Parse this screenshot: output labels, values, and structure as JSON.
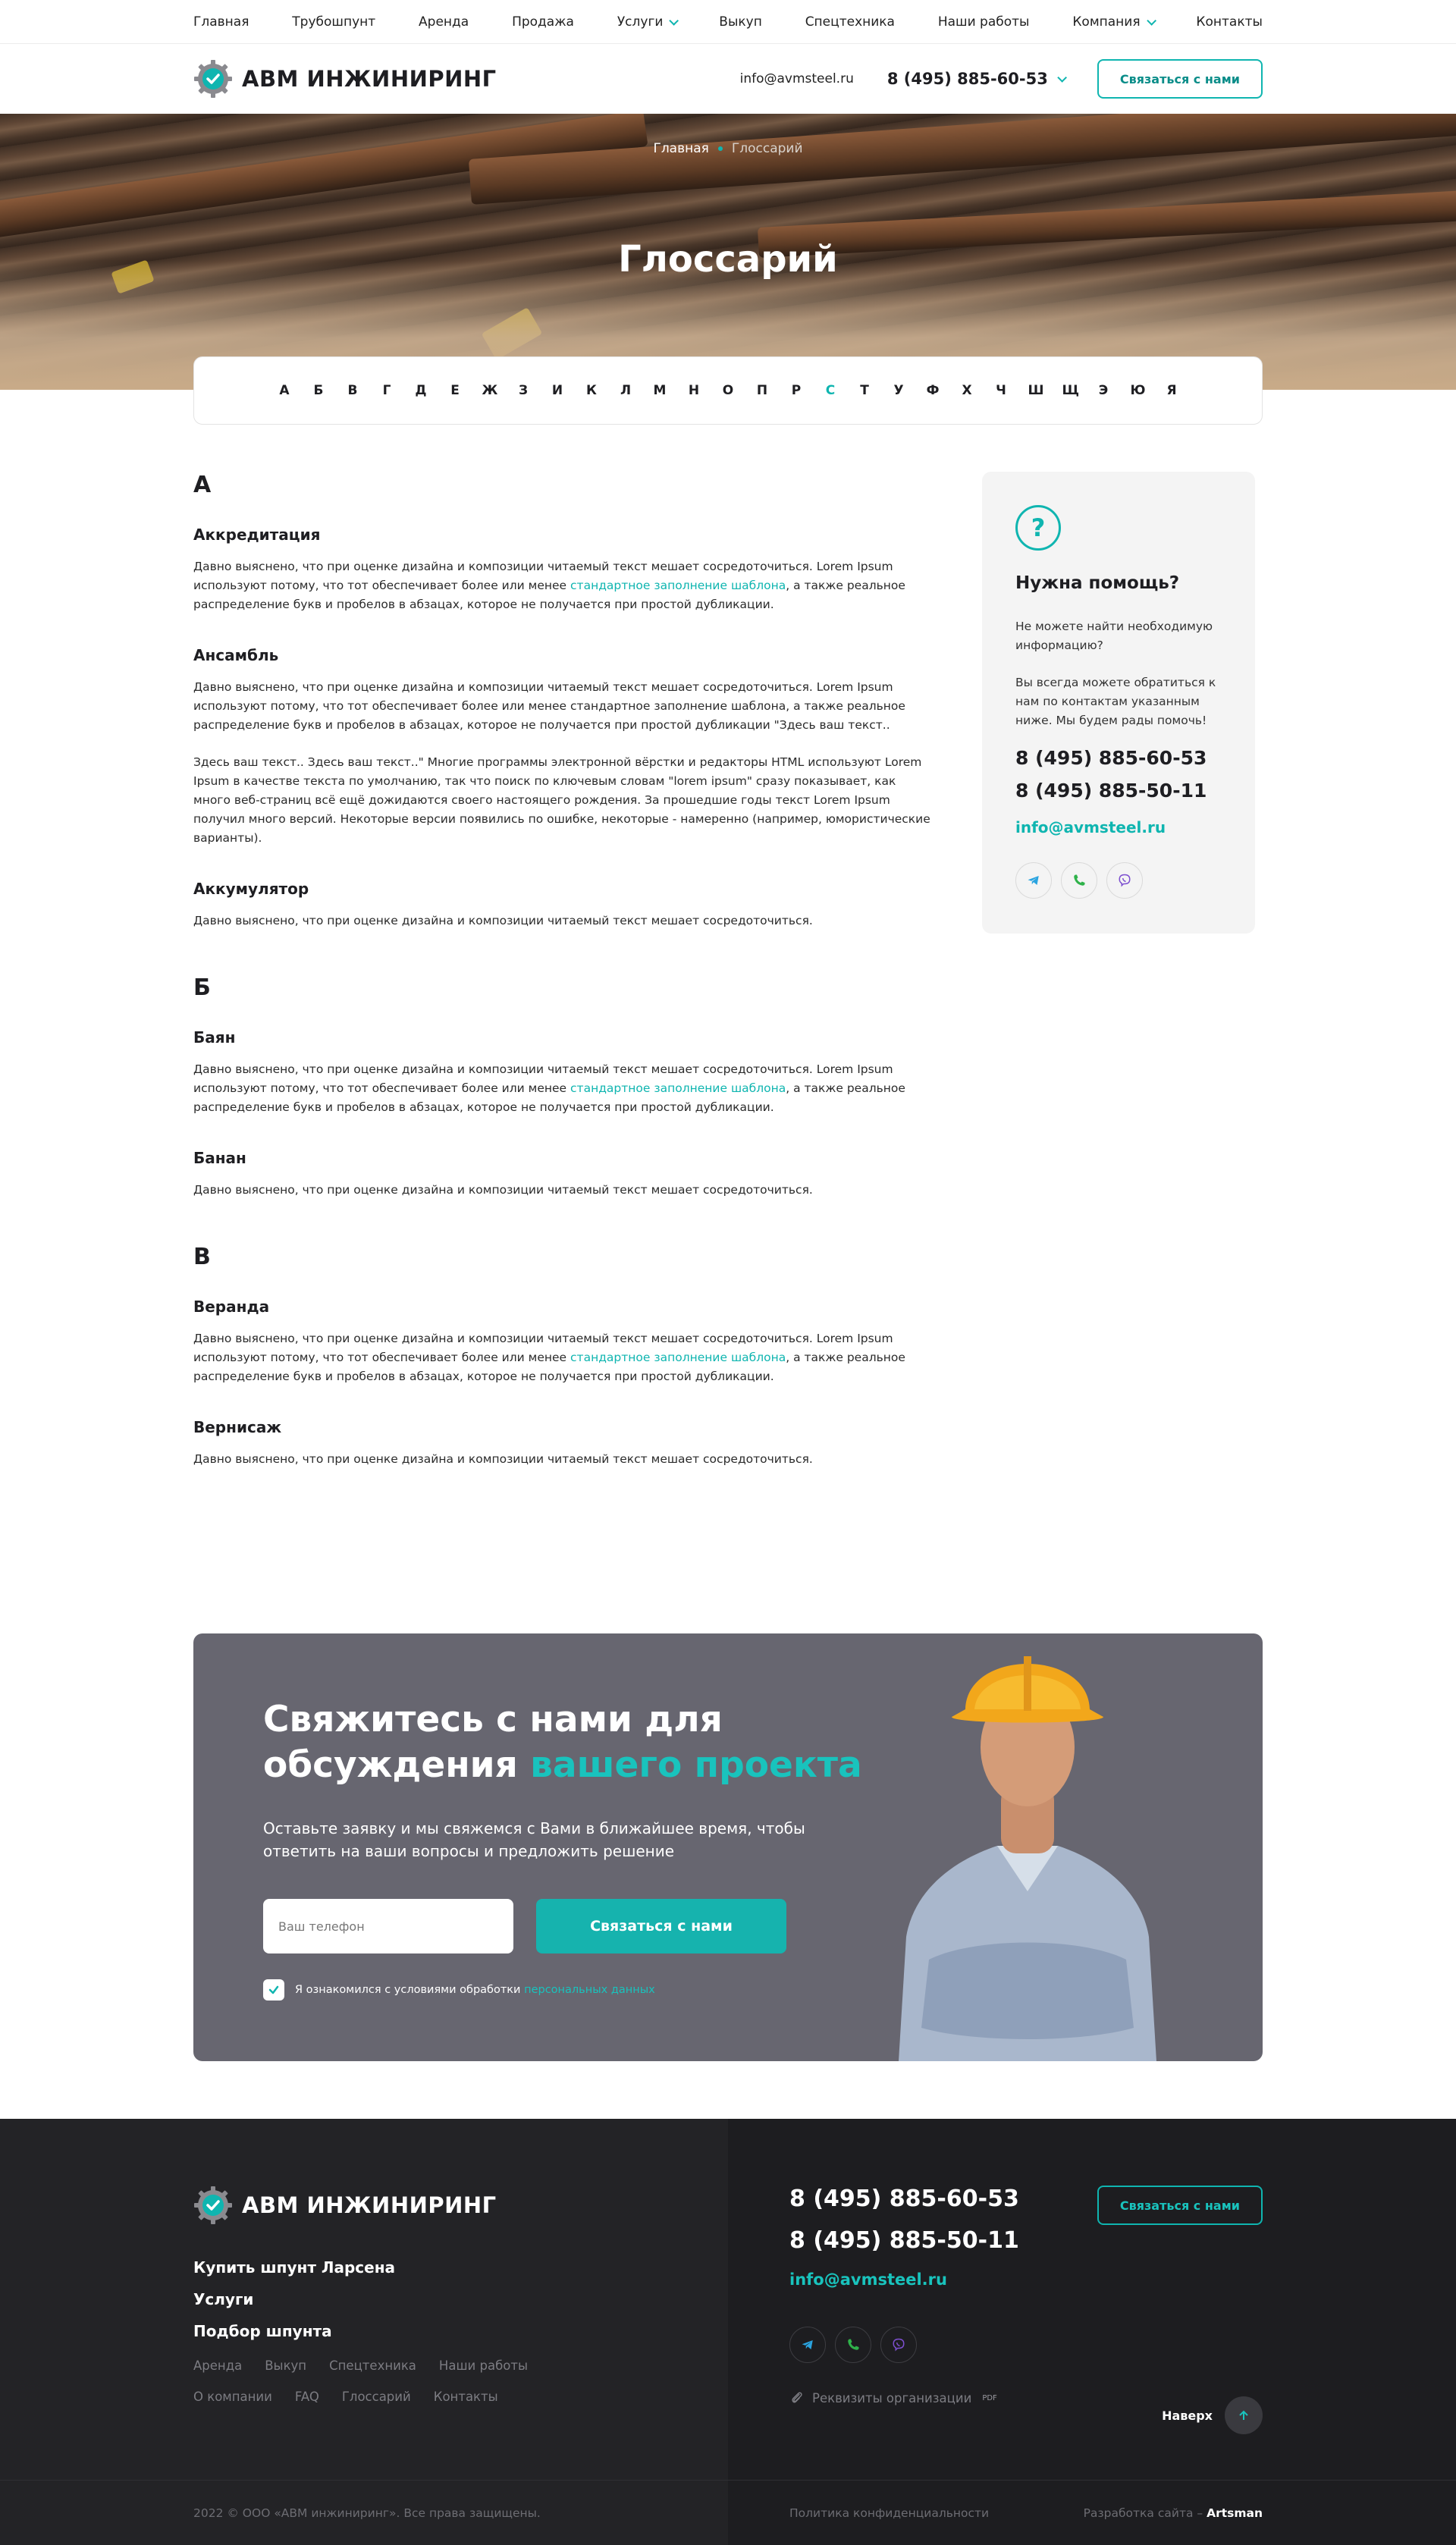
{
  "topnav": [
    {
      "label": "Главная",
      "dropdown": false
    },
    {
      "label": "Трубошпунт",
      "dropdown": false
    },
    {
      "label": "Аренда",
      "dropdown": false
    },
    {
      "label": "Продажа",
      "dropdown": false
    },
    {
      "label": "Услуги",
      "dropdown": true
    },
    {
      "label": "Выкуп",
      "dropdown": false
    },
    {
      "label": "Спецтехника",
      "dropdown": false
    },
    {
      "label": "Наши работы",
      "dropdown": false
    },
    {
      "label": "Компания",
      "dropdown": true
    },
    {
      "label": "Контакты",
      "dropdown": false
    }
  ],
  "header": {
    "logo_text": "АВМ ИНЖИНИРИНГ",
    "email": "info@avmsteel.ru",
    "phone": "8 (495) 885-60-53",
    "contact_button": "Связаться с нами"
  },
  "hero": {
    "breadcrumb_home": "Главная",
    "breadcrumb_current": "Глоссарий",
    "title": "Глоссарий"
  },
  "alphabet": {
    "letters": [
      "А",
      "Б",
      "В",
      "Г",
      "Д",
      "Е",
      "Ж",
      "З",
      "И",
      "К",
      "Л",
      "М",
      "Н",
      "О",
      "П",
      "Р",
      "С",
      "Т",
      "У",
      "Ф",
      "Х",
      "Ч",
      "Ш",
      "Щ",
      "Э",
      "Ю",
      "Я"
    ],
    "active": "С"
  },
  "glossary": [
    {
      "letter": "А",
      "terms": [
        {
          "title": "Аккредитация",
          "paragraphs": [
            {
              "before": "Давно выяснено, что при оценке дизайна и композиции читаемый текст мешает сосредоточиться. Lorem Ipsum используют потому, что тот обеспечивает более или менее ",
              "link": "стандартное заполнение шаблона",
              "after": ", а также реальное распределение букв и пробелов в абзацах, которое не получается при простой дубликации."
            }
          ]
        },
        {
          "title": "Ансамбль",
          "paragraphs": [
            {
              "before": "Давно выяснено, что при оценке дизайна и композиции читаемый текст мешает сосредоточиться. Lorem Ipsum используют потому, что тот обеспечивает более или менее стандартное заполнение шаблона, а также реальное распределение букв и пробелов в абзацах, которое не получается при простой дубликации \"Здесь ваш текст..",
              "link": "",
              "after": ""
            },
            {
              "before": "Здесь ваш текст.. Здесь ваш текст..\" Многие программы электронной вёрстки и редакторы HTML используют Lorem Ipsum в качестве текста по умолчанию, так что поиск по ключевым словам \"lorem ipsum\" сразу показывает, как много веб-страниц всё ещё дожидаются своего настоящего рождения. За прошедшие годы текст Lorem Ipsum получил много версий. Некоторые версии появились по ошибке, некоторые - намеренно (например, юмористические варианты).",
              "link": "",
              "after": ""
            }
          ]
        },
        {
          "title": "Аккумулятор",
          "paragraphs": [
            {
              "before": "Давно выяснено, что при оценке дизайна и композиции читаемый текст мешает сосредоточиться.",
              "link": "",
              "after": ""
            }
          ]
        }
      ]
    },
    {
      "letter": "Б",
      "terms": [
        {
          "title": "Баян",
          "paragraphs": [
            {
              "before": "Давно выяснено, что при оценке дизайна и композиции читаемый текст мешает сосредоточиться. Lorem Ipsum используют потому, что тот обеспечивает более или менее ",
              "link": "стандартное заполнение шаблона",
              "after": ", а также реальное распределение букв и пробелов в абзацах, которое не получается при простой дубликации."
            }
          ]
        },
        {
          "title": "Банан",
          "paragraphs": [
            {
              "before": "Давно выяснено, что при оценке дизайна и композиции читаемый текст мешает сосредоточиться.",
              "link": "",
              "after": ""
            }
          ]
        }
      ]
    },
    {
      "letter": "В",
      "terms": [
        {
          "title": "Веранда",
          "paragraphs": [
            {
              "before": "Давно выяснено, что при оценке дизайна и композиции читаемый текст мешает сосредоточиться. Lorem Ipsum используют потому, что тот обеспечивает более или менее ",
              "link": "стандартное заполнение шаблона",
              "after": ", а также реальное распределение букв и пробелов в абзацах, которое не получается при простой дубликации."
            }
          ]
        },
        {
          "title": "Вернисаж",
          "paragraphs": [
            {
              "before": "Давно выяснено, что при оценке дизайна и композиции читаемый текст мешает сосредоточиться.",
              "link": "",
              "after": ""
            }
          ]
        }
      ]
    }
  ],
  "help": {
    "title": "Нужна помощь?",
    "text1": "Не можете найти необходимую информацию?",
    "text2": "Вы всегда можете обратиться к нам по контактам указанным ниже. Мы будем рады помочь!",
    "phone1": "8 (495) 885-60-53",
    "phone2": "8 (495) 885-50-11",
    "email": "info@avmsteel.ru"
  },
  "cta": {
    "title_line1": "Свяжитесь с нами для",
    "title_line2_plain": "обсуждения ",
    "title_line2_accent": "вашего проекта",
    "lead": "Оставьте заявку и мы свяжемся с Вами в ближайшее время, чтобы ответить на ваши вопросы и предложить решение",
    "phone_placeholder": "Ваш телефон",
    "button": "Связаться с нами",
    "consent_text": "Я ознакомился с условиями обработки ",
    "consent_link": "персональных данных"
  },
  "footer": {
    "logo_text": "АВМ ИНЖИНИРИНГ",
    "links_bold": [
      "Купить шпунт Ларсена",
      "Услуги",
      "Подбор шпунта"
    ],
    "links_row1": [
      "Аренда",
      "Выкуп",
      "Спецтехника",
      "Наши работы"
    ],
    "links_row2": [
      "О компании",
      "FAQ",
      "Глоссарий",
      "Контакты"
    ],
    "phone1": "8 (495) 885-60-53",
    "phone2": "8 (495) 885-50-11",
    "email": "info@avmsteel.ru",
    "contact_button": "Связаться с нами",
    "requisites": "Реквизиты организации",
    "requisites_badge": "PDF",
    "to_top": "Наверх",
    "copyright": "2022 © ООО «АВМ инжиниринг». Все права защищены.",
    "privacy": "Политика конфиденциальности",
    "dev_label": "Разработка сайта – ",
    "dev_name": "Artsman"
  },
  "colors": {
    "accent": "#0fb5b0",
    "cta_bg": "#676670",
    "footer_bg": "#232326"
  },
  "icons": {
    "social": [
      "telegram-icon",
      "phone-icon",
      "viber-icon"
    ]
  }
}
